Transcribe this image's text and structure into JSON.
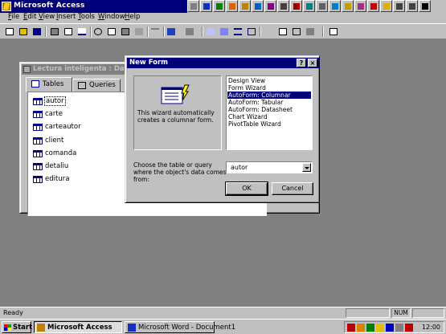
{
  "app": {
    "title": "Microsoft Access"
  },
  "menu": [
    "File",
    "Edit",
    "View",
    "Insert",
    "Tools",
    "Window",
    "Help"
  ],
  "menu_mnemonics": [
    "F",
    "E",
    "V",
    "I",
    "T",
    "W",
    "H"
  ],
  "database_window": {
    "title": "Lectura inteligenta : Database",
    "tabs": [
      {
        "label": "Tables",
        "active": true
      },
      {
        "label": "Queries",
        "active": false
      }
    ],
    "tables": [
      "autor",
      "carte",
      "carteautor",
      "client",
      "comanda",
      "detaliu",
      "editura"
    ],
    "selected_table": "autor"
  },
  "new_form_dialog": {
    "title": "New Form",
    "help_button": "?",
    "close_button": "×",
    "description": "This wizard automatically creates a columnar form.",
    "form_types": [
      "Design View",
      "Form Wizard",
      "AutoForm: Columnar",
      "AutoForm: Tabular",
      "AutoForm: Datasheet",
      "Chart Wizard",
      "PivotTable Wizard"
    ],
    "selected_type": "AutoForm: Columnar",
    "choose_label": "Choose the table or query where the object's data comes from:",
    "source_value": "autor",
    "ok_label": "OK",
    "cancel_label": "Cancel"
  },
  "status_bar": {
    "text": "Ready",
    "num": "NUM"
  },
  "taskbar": {
    "start_label": "Start",
    "tasks": [
      {
        "label": "Microsoft Access",
        "active": true
      },
      {
        "label": "Microsoft Word - Document1",
        "active": false
      }
    ],
    "clock": "12:00"
  },
  "colors": {
    "title_active": "#00007b",
    "title_inactive": "#808080",
    "face": "#c0c0c0",
    "desktop": "#808080",
    "selection": "#00007b"
  }
}
